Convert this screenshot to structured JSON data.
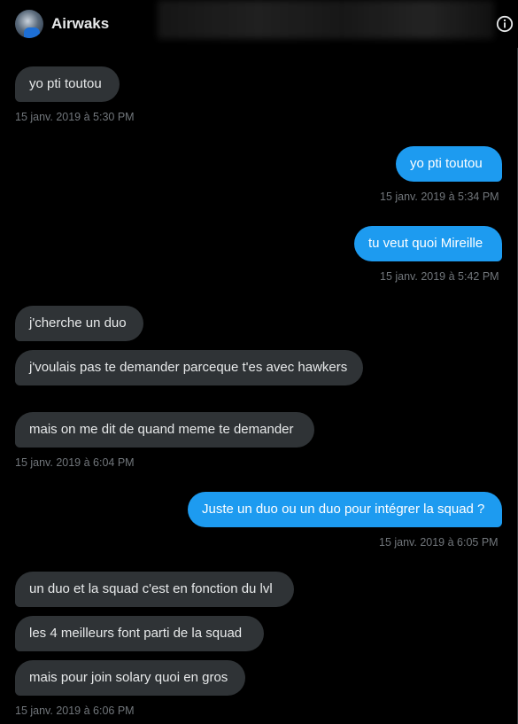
{
  "header": {
    "name": "Airwaks",
    "avatar_icon": "user-avatar",
    "info_icon": "info-icon"
  },
  "messages": [
    {
      "dir": "in",
      "text": "yo pti toutou"
    },
    {
      "dir": "out",
      "text": "yo pti toutou"
    },
    {
      "dir": "out",
      "text": "tu veut quoi Mireille"
    },
    {
      "dir": "in",
      "text": "j'cherche un duo"
    },
    {
      "dir": "in",
      "text": "j'voulais pas te demander parceque t'es avec hawkers"
    },
    {
      "dir": "in",
      "text": "mais on me dit de quand meme te demander"
    },
    {
      "dir": "out",
      "text": "Juste un duo ou un duo pour intégrer la squad ?"
    },
    {
      "dir": "in",
      "text": "un duo et la squad c'est en fonction du lvl"
    },
    {
      "dir": "in",
      "text": "les 4 meilleurs font parti de la squad"
    },
    {
      "dir": "in",
      "text": "mais pour join solary quoi en gros"
    }
  ],
  "timestamps": [
    "15 janv. 2019 à 5:30 PM",
    "15 janv. 2019 à 5:34 PM",
    "15 janv. 2019 à 5:42 PM",
    "15 janv. 2019 à 6:04 PM",
    "15 janv. 2019 à 6:05 PM",
    "15 janv. 2019 à 6:06 PM"
  ],
  "colors": {
    "background": "#000000",
    "incoming_bubble": "#2f3336",
    "outgoing_bubble": "#1d9bf0",
    "timestamp": "#71767b",
    "text": "#e7e9ea"
  }
}
